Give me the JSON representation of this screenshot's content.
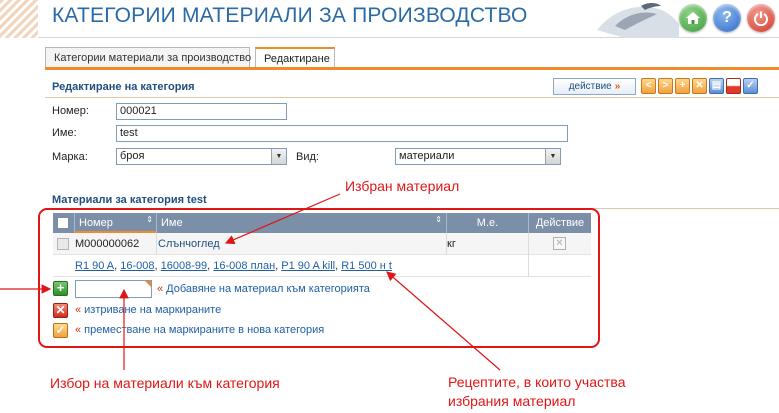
{
  "header": {
    "title": "КАТЕГОРИИ МАТЕРИАЛИ ЗА ПРОИЗВОДСТВО",
    "home_icon": "home-icon",
    "help_icon": "help-icon",
    "help_glyph": "?",
    "power_icon": "power-icon"
  },
  "tabs": [
    {
      "label": "Категории материали за производство",
      "active": false
    },
    {
      "label": "Редактиране",
      "active": true
    }
  ],
  "edit_section": {
    "title": "Редактиране на категория",
    "action_label": "действие",
    "action_arrow": "»",
    "toolbar_icons": [
      "chevron-left-icon",
      "chevron-right-icon",
      "plus-icon",
      "close-icon",
      "print-icon",
      "flag-icon",
      "check-icon"
    ],
    "toolbar_glyphs": {
      "prev": "<",
      "next": ">",
      "add": "+",
      "close": "✕",
      "print": "▤",
      "check": "✓"
    }
  },
  "form": {
    "number_label": "Номер:",
    "number_value": "000021",
    "name_label": "Име:",
    "name_value": "test",
    "brand_label": "Марка:",
    "brand_value": "броя",
    "kind_label": "Вид:",
    "kind_value": "материали",
    "dropdown_glyph": "▼"
  },
  "materials": {
    "title": "Материали за категория test",
    "columns": {
      "number": "Номер",
      "name": "Име",
      "unit": "М.е.",
      "action": "Действие"
    },
    "sort_glyph": "⇕",
    "rows": [
      {
        "number": "M000000062",
        "name": "Слънчоглед",
        "unit": "кг"
      }
    ],
    "recipes": [
      "R1 90 A",
      "16-008",
      "16008-99",
      "16-008 план",
      "P1 90 A kill",
      "R1 500 н t"
    ],
    "recipe_separator": ",",
    "delete_glyph": "✕",
    "add_glyph": "+",
    "add_label": "Добавяне на материал към категорията",
    "delete_marked_label": "изтриване на маркираните",
    "move_marked_label": "преместване на маркираните в нова категория",
    "link_prefix": "«"
  },
  "annotations": {
    "selected_material": "Избран материал",
    "choose_materials": "Избор на материали към категория",
    "recipes_line1": "Рецептите, в които участва",
    "recipes_line2": "избрания материал"
  },
  "colors": {
    "accent": "#f08a2a",
    "title_blue": "#2a6aa5",
    "annotation_red": "#e01616",
    "header_table": "#7c8fa8",
    "link": "#1f5fa5"
  }
}
